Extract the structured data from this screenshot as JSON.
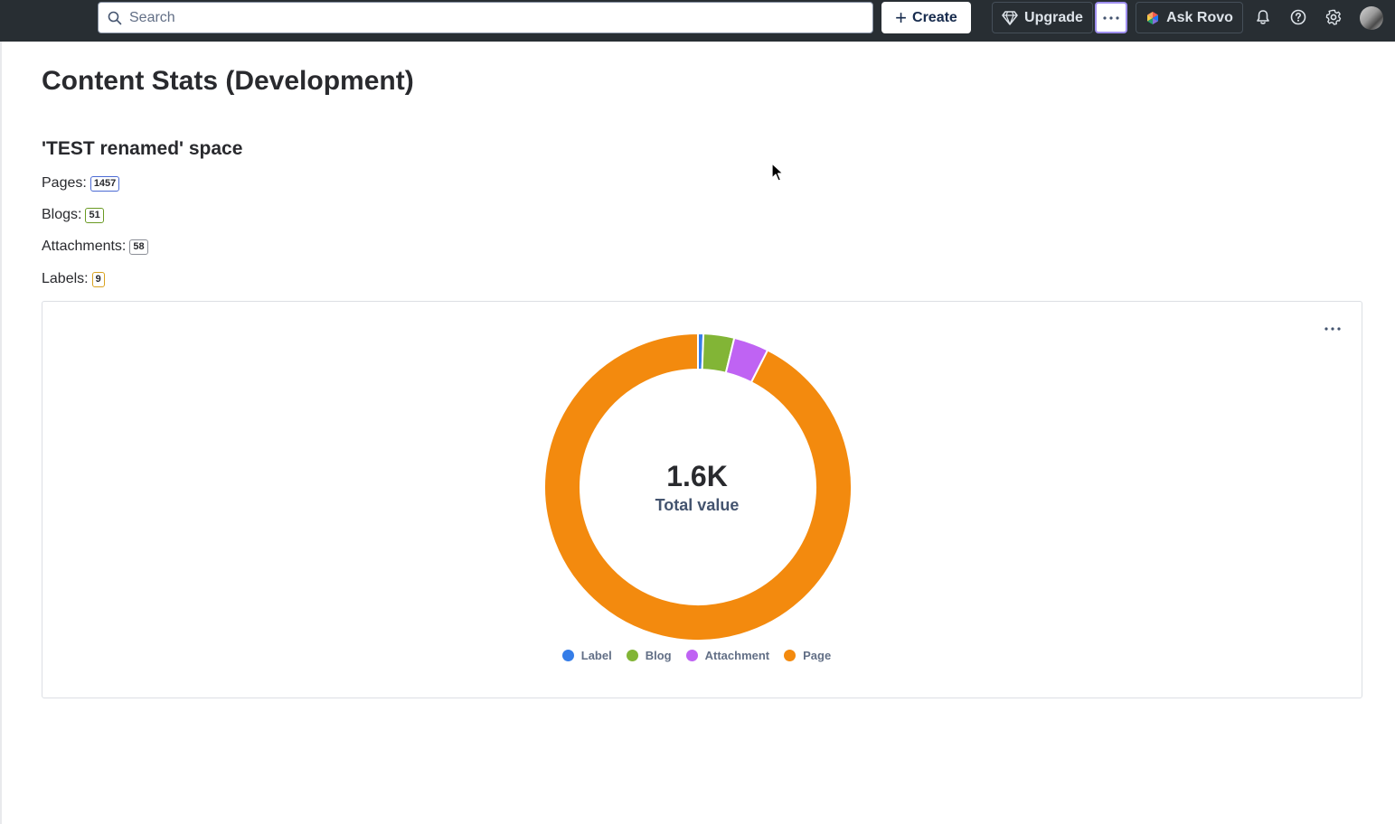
{
  "topbar": {
    "search_placeholder": "Search",
    "create_label": "Create",
    "upgrade_label": "Upgrade",
    "more_icon": "ellipsis-icon",
    "rovo_label": "Ask Rovo",
    "icons": [
      "search-icon",
      "plus-icon",
      "diamond-icon",
      "rovo-icon",
      "bell-icon",
      "help-icon",
      "gear-icon",
      "avatar"
    ]
  },
  "page": {
    "title": "Content Stats (Development)",
    "space_heading": "'TEST renamed' space",
    "stats": [
      {
        "label": "Pages:",
        "value": "1457",
        "color": "#4c6bd4"
      },
      {
        "label": "Blogs:",
        "value": "51",
        "color": "#6a9a23"
      },
      {
        "label": "Attachments:",
        "value": "58",
        "color": "#8c8f97"
      },
      {
        "label": "Labels:",
        "value": "9",
        "color": "#d9a21f"
      }
    ]
  },
  "chart_data": {
    "type": "pie",
    "variant": "donut",
    "categories": [
      "Label",
      "Blog",
      "Attachment",
      "Page"
    ],
    "values": [
      9,
      51,
      58,
      1457
    ],
    "colors": [
      "#357de8",
      "#82b536",
      "#bf63f3",
      "#f38a0e"
    ],
    "center_value": "1.6K",
    "center_label": "Total value",
    "legend_position": "bottom"
  }
}
